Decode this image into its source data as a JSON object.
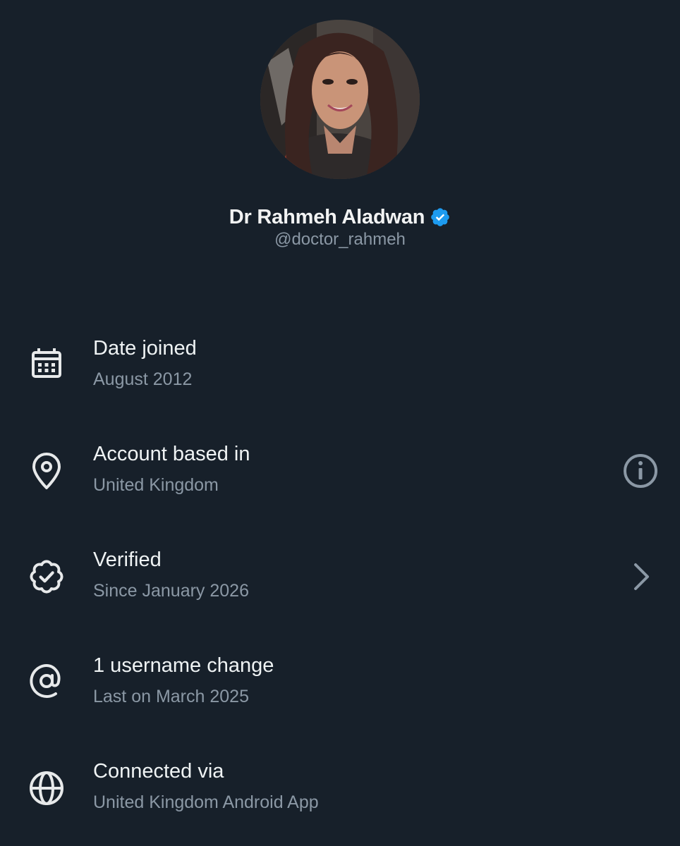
{
  "profile": {
    "display_name": "Dr Rahmeh Aladwan",
    "handle": "@doctor_rahmeh",
    "verified_badge_color": "#1d9bf0"
  },
  "rows": [
    {
      "icon": "calendar-icon",
      "title": "Date joined",
      "subtitle": "August 2012"
    },
    {
      "icon": "location-pin-icon",
      "title": "Account based in",
      "subtitle": "United Kingdom",
      "action_icon": "info-icon"
    },
    {
      "icon": "verified-seal-icon",
      "title": "Verified",
      "subtitle": "Since January 2026",
      "action_icon": "chevron-right-icon"
    },
    {
      "icon": "at-sign-icon",
      "title": "1 username change",
      "subtitle": "Last on March 2025"
    },
    {
      "icon": "globe-icon",
      "title": "Connected via",
      "subtitle": "United Kingdom Android App"
    }
  ],
  "colors": {
    "background": "#17202a",
    "primary_text": "#e7e9ea",
    "secondary_text": "#8b98a5",
    "accent_blue": "#1d9bf0"
  }
}
